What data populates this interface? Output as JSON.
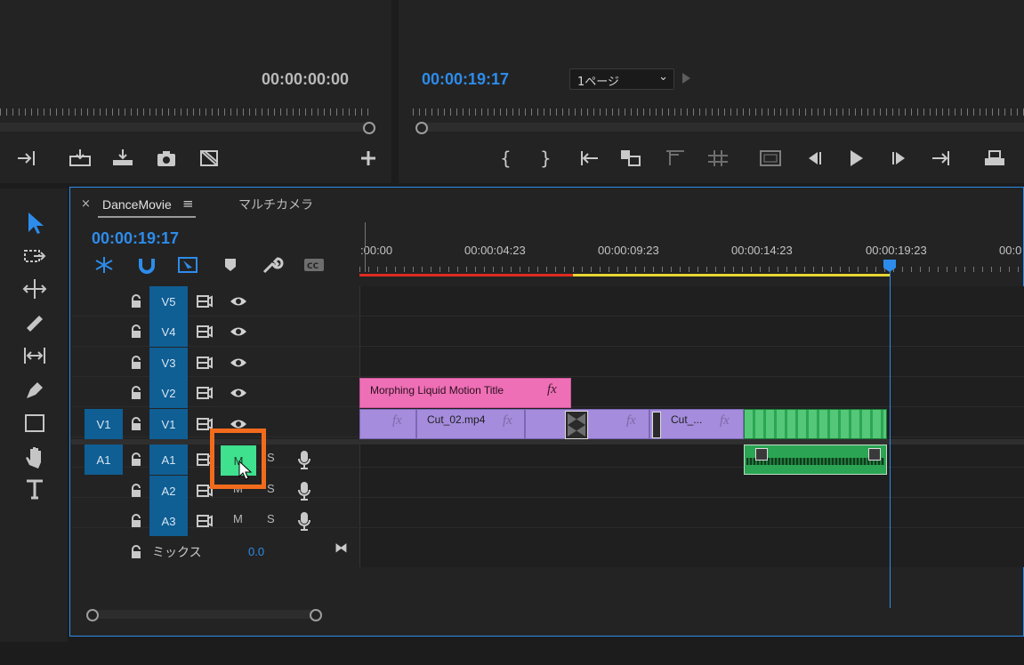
{
  "colors": {
    "accent_blue": "#2d8ceb",
    "track_blue": "#0f5e94",
    "clip_purple": "#a58cdc",
    "title_pink": "#ee6fb5",
    "clip_green": "#3fc16d",
    "mute_green": "#3fe08e",
    "highlight_orange": "#f26b1d",
    "render_red": "#e02b20",
    "render_yellow": "#e8d531"
  },
  "source_monitor": {
    "timecode": "00:00:00:00"
  },
  "program_monitor": {
    "timecode": "00:00:19:17",
    "page_select": "1ページ"
  },
  "timeline": {
    "tab_name": "DanceMovie",
    "other_tab": "マルチカメラ",
    "timecode": "00:00:19:17",
    "ruler_labels": [
      ":00:00",
      "00:00:04:23",
      "00:00:09:23",
      "00:00:14:23",
      "00:00:19:23",
      "00:0"
    ],
    "video_tracks": [
      {
        "name": "V5",
        "source": ""
      },
      {
        "name": "V4",
        "source": ""
      },
      {
        "name": "V3",
        "source": ""
      },
      {
        "name": "V2",
        "source": ""
      },
      {
        "name": "V1",
        "source": "V1"
      }
    ],
    "audio_tracks": [
      {
        "name": "A1",
        "source": "A1",
        "mute": "M",
        "solo": "S"
      },
      {
        "name": "A2",
        "source": "",
        "mute": "M",
        "solo": "S"
      },
      {
        "name": "A3",
        "source": "",
        "mute": "M",
        "solo": "S"
      }
    ],
    "mix": {
      "label": "ミックス",
      "value": "0.0"
    },
    "clips": {
      "title": "Morphing Liquid Motion Title",
      "cut02": "Cut_02.mp4",
      "cut_short": "Cut_...",
      "fx": "fx"
    }
  }
}
